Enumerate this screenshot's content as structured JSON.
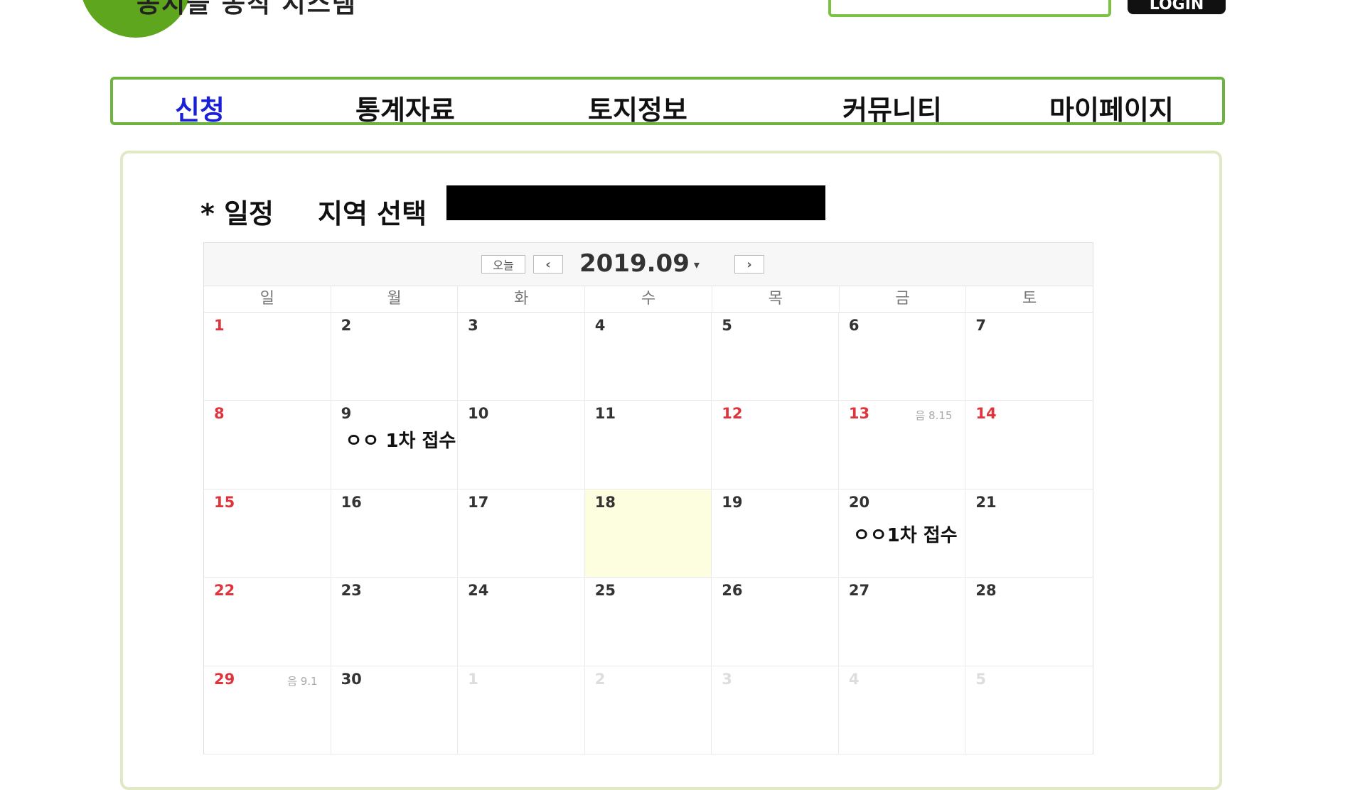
{
  "header": {
    "logo_text": "농지을 농직 시스템",
    "login_label": "LOGIN"
  },
  "nav": {
    "items": [
      {
        "label": "신청",
        "active": true
      },
      {
        "label": "통계자료",
        "active": false
      },
      {
        "label": "토지정보",
        "active": false
      },
      {
        "label": "커뮤니티",
        "active": false
      },
      {
        "label": "마이페이지",
        "active": false
      }
    ]
  },
  "schedule": {
    "title": "* 일정",
    "region_label": "지역 선택"
  },
  "calendar": {
    "today_label": "오늘",
    "prev_icon": "‹",
    "next_icon": "›",
    "month_label": "2019.09",
    "weekdays": [
      "일",
      "월",
      "화",
      "수",
      "목",
      "금",
      "토"
    ],
    "days": [
      {
        "n": "1"
      },
      {
        "n": "2"
      },
      {
        "n": "3"
      },
      {
        "n": "4"
      },
      {
        "n": "5"
      },
      {
        "n": "6"
      },
      {
        "n": "7"
      },
      {
        "n": "8"
      },
      {
        "n": "9"
      },
      {
        "n": "10"
      },
      {
        "n": "11"
      },
      {
        "n": "12"
      },
      {
        "n": "13"
      },
      {
        "n": "14"
      },
      {
        "n": "15"
      },
      {
        "n": "16"
      },
      {
        "n": "17"
      },
      {
        "n": "18"
      },
      {
        "n": "19"
      },
      {
        "n": "20"
      },
      {
        "n": "21"
      },
      {
        "n": "22"
      },
      {
        "n": "23"
      },
      {
        "n": "24"
      },
      {
        "n": "25"
      },
      {
        "n": "26"
      },
      {
        "n": "27"
      },
      {
        "n": "28"
      },
      {
        "n": "29"
      },
      {
        "n": "30"
      },
      {
        "n": "1"
      },
      {
        "n": "2"
      },
      {
        "n": "3"
      },
      {
        "n": "4"
      },
      {
        "n": "5"
      }
    ],
    "lunar_13": "음 8.15",
    "lunar_29": "음 9.1",
    "event_9": "ㅇㅇ 1차 접수",
    "event_20": "ㅇㅇ1차 접수"
  },
  "colors": {
    "brand_green": "#6cb33f",
    "active_nav": "#1a20d8",
    "holiday_red": "#e0343c",
    "today_highlight": "#fdfde0"
  }
}
